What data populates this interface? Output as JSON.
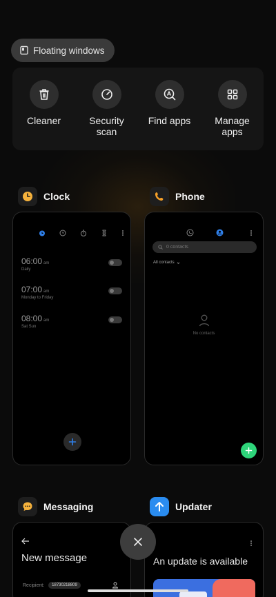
{
  "floating_windows": {
    "label": "Floating windows",
    "icon": "floating-window-icon"
  },
  "tools": [
    {
      "label": "Cleaner",
      "icon": "trash-icon"
    },
    {
      "label": "Security\nscan",
      "icon": "security-gauge-icon"
    },
    {
      "label": "Find apps",
      "icon": "app-search-icon"
    },
    {
      "label": "Manage\napps",
      "icon": "grid-icon"
    }
  ],
  "apps": {
    "clock": {
      "title": "Clock",
      "alarms": [
        {
          "time": "06:00",
          "ampm": "am",
          "repeat": "Daily"
        },
        {
          "time": "07:00",
          "ampm": "am",
          "repeat": "Monday to Friday"
        },
        {
          "time": "08:00",
          "ampm": "am",
          "repeat": "Sat Sun"
        }
      ]
    },
    "phone": {
      "title": "Phone",
      "search_placeholder": "0 contacts",
      "filter_label": "All contacts",
      "empty_label": "No contacts"
    },
    "messaging": {
      "title": "Messaging",
      "heading": "New message",
      "recipient_label": "Recipient:",
      "recipient_value": "18730218809"
    },
    "updater": {
      "title": "Updater",
      "message": "An update is available"
    }
  },
  "colors": {
    "clock_accent": "#2f7fe8",
    "phone_fab": "#2ed47a",
    "clock_icon": "#f6b23c",
    "phone_icon": "#f6a028",
    "messaging_icon": "#f6b23c",
    "updater_icon": "#2a8cf0"
  }
}
